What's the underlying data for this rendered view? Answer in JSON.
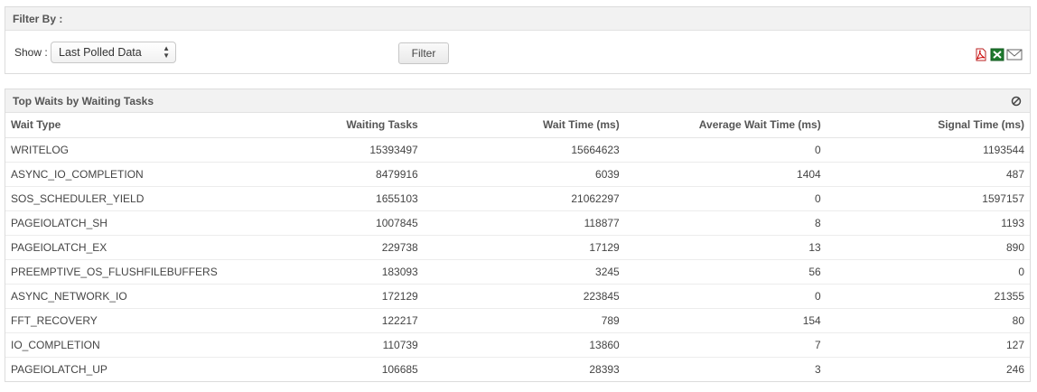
{
  "filter": {
    "title": "Filter By :",
    "show_label": "Show :",
    "show_value": "Last Polled Data",
    "filter_button": "Filter"
  },
  "icons": [
    "pdf-icon",
    "excel-icon",
    "email-icon",
    "close-icon"
  ],
  "waits": {
    "title": "Top Waits by Waiting Tasks",
    "columns": [
      "Wait Type",
      "Waiting Tasks",
      "Wait Time (ms)",
      "Average Wait Time (ms)",
      "Signal Time (ms)"
    ],
    "rows": [
      [
        "WRITELOG",
        "15393497",
        "15664623",
        "0",
        "1193544"
      ],
      [
        "ASYNC_IO_COMPLETION",
        "8479916",
        "6039",
        "1404",
        "487"
      ],
      [
        "SOS_SCHEDULER_YIELD",
        "1655103",
        "21062297",
        "0",
        "1597157"
      ],
      [
        "PAGEIOLATCH_SH",
        "1007845",
        "118877",
        "8",
        "1193"
      ],
      [
        "PAGEIOLATCH_EX",
        "229738",
        "17129",
        "13",
        "890"
      ],
      [
        "PREEMPTIVE_OS_FLUSHFILEBUFFERS",
        "183093",
        "3245",
        "56",
        "0"
      ],
      [
        "ASYNC_NETWORK_IO",
        "172129",
        "223845",
        "0",
        "21355"
      ],
      [
        "FFT_RECOVERY",
        "122217",
        "789",
        "154",
        "80"
      ],
      [
        "IO_COMPLETION",
        "110739",
        "13860",
        "7",
        "127"
      ],
      [
        "PAGEIOLATCH_UP",
        "106685",
        "28393",
        "3",
        "246"
      ]
    ]
  }
}
